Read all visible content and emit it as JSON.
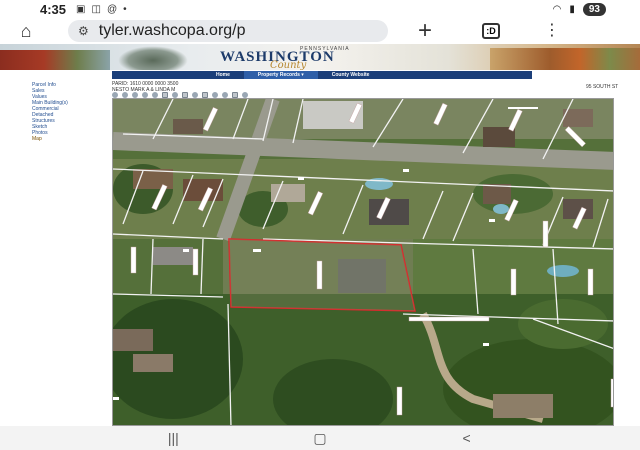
{
  "status_bar": {
    "time": "4:35",
    "battery": "93"
  },
  "browser": {
    "url": "tyler.washcopa.org/p"
  },
  "banner": {
    "title": "WASHINGTON",
    "subtitle": "PENNSYLVANIA",
    "script": "County"
  },
  "site_nav": {
    "items": [
      "Home",
      "Property Records ▾",
      "County Website"
    ]
  },
  "sidebar": {
    "items": [
      "Parcel Info",
      "Sales",
      "Values",
      "Main Building(s)",
      "Commercial",
      "Detached",
      "Structures",
      "Sketch",
      "Photos",
      "Map"
    ]
  },
  "parcel": {
    "parid": "PARID: 1610 0000 0000 3500",
    "owner": "NESTO MARK A & LINDA M",
    "address": "95 SOUTH ST"
  },
  "icons": {
    "home": "home-icon",
    "tune": "tune-icon",
    "new_tab": "plus-icon",
    "tabs": "tab-switcher-icon",
    "menu": "kebab-menu-icon"
  },
  "colors": {
    "nav_bar": "#1c3f7a",
    "parcel_outline": "#e0242a",
    "lot_lines": "#f2f2f2"
  }
}
